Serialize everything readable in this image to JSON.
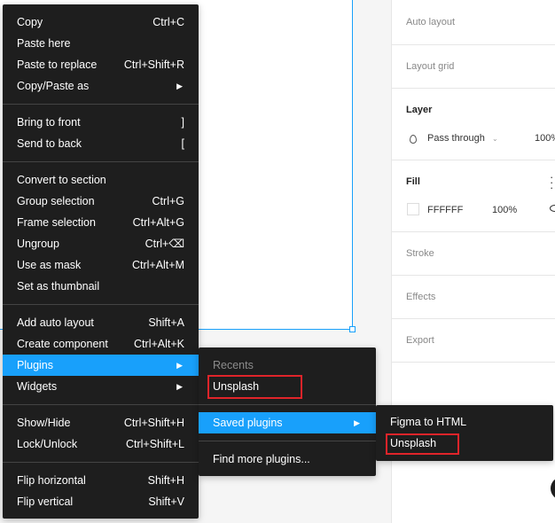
{
  "context_menu": {
    "groups": [
      [
        {
          "label": "Copy",
          "shortcut": "Ctrl+C"
        },
        {
          "label": "Paste here",
          "shortcut": ""
        },
        {
          "label": "Paste to replace",
          "shortcut": "Ctrl+Shift+R"
        },
        {
          "label": "Copy/Paste as",
          "shortcut": "",
          "submenu": true
        }
      ],
      [
        {
          "label": "Bring to front",
          "shortcut": "]"
        },
        {
          "label": "Send to back",
          "shortcut": "["
        }
      ],
      [
        {
          "label": "Convert to section",
          "shortcut": ""
        },
        {
          "label": "Group selection",
          "shortcut": "Ctrl+G"
        },
        {
          "label": "Frame selection",
          "shortcut": "Ctrl+Alt+G"
        },
        {
          "label": "Ungroup",
          "shortcut": "Ctrl+⌫"
        },
        {
          "label": "Use as mask",
          "shortcut": "Ctrl+Alt+M"
        },
        {
          "label": "Set as thumbnail",
          "shortcut": ""
        }
      ],
      [
        {
          "label": "Add auto layout",
          "shortcut": "Shift+A"
        },
        {
          "label": "Create component",
          "shortcut": "Ctrl+Alt+K"
        },
        {
          "label": "Plugins",
          "shortcut": "",
          "submenu": true,
          "active": true
        },
        {
          "label": "Widgets",
          "shortcut": "",
          "submenu": true
        }
      ],
      [
        {
          "label": "Show/Hide",
          "shortcut": "Ctrl+Shift+H"
        },
        {
          "label": "Lock/Unlock",
          "shortcut": "Ctrl+Shift+L"
        }
      ],
      [
        {
          "label": "Flip horizontal",
          "shortcut": "Shift+H"
        },
        {
          "label": "Flip vertical",
          "shortcut": "Shift+V"
        }
      ]
    ]
  },
  "plugins_menu": {
    "recents_header": "Recents",
    "recent_item": "Unsplash",
    "saved_plugins": "Saved plugins",
    "find_more": "Find more plugins..."
  },
  "saved_plugins_menu": {
    "items": [
      "Figma to HTML",
      "Unsplash"
    ]
  },
  "panel": {
    "auto_layout": "Auto layout",
    "layout_grid": "Layout grid",
    "layer": {
      "title": "Layer",
      "blend_mode": "Pass through",
      "opacity": "100%"
    },
    "fill": {
      "title": "Fill",
      "hex": "FFFFFF",
      "opacity": "100%"
    },
    "stroke": "Stroke",
    "effects": "Effects",
    "export": "Export"
  },
  "colors": {
    "menu_bg": "#1e1e1e",
    "accent": "#18a0fb",
    "highlight_box": "#e0242a"
  },
  "icons": {
    "submenu_arrow": "▶",
    "chevron": "chevron-down-icon",
    "blend": "drop-icon",
    "eye": "eye-icon",
    "more": "more-vertical-icon"
  }
}
